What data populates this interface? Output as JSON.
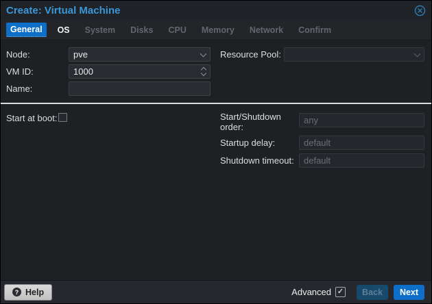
{
  "dialog": {
    "title": "Create: Virtual Machine"
  },
  "tabs": [
    {
      "label": "General",
      "state": "active"
    },
    {
      "label": "OS",
      "state": "enabled"
    },
    {
      "label": "System",
      "state": "disabled"
    },
    {
      "label": "Disks",
      "state": "disabled"
    },
    {
      "label": "CPU",
      "state": "disabled"
    },
    {
      "label": "Memory",
      "state": "disabled"
    },
    {
      "label": "Network",
      "state": "disabled"
    },
    {
      "label": "Confirm",
      "state": "disabled"
    }
  ],
  "form": {
    "node": {
      "label": "Node:",
      "value": "pve"
    },
    "vm_id": {
      "label": "VM ID:",
      "value": "1000"
    },
    "name": {
      "label": "Name:",
      "value": ""
    },
    "resource_pool": {
      "label": "Resource Pool:",
      "value": ""
    },
    "start_at_boot": {
      "label": "Start at boot:",
      "checked": false
    },
    "startup_order": {
      "label": "Start/Shutdown order:",
      "placeholder": "any",
      "value": ""
    },
    "startup_delay": {
      "label": "Startup delay:",
      "placeholder": "default",
      "value": ""
    },
    "shutdown_timeout": {
      "label": "Shutdown timeout:",
      "placeholder": "default",
      "value": ""
    }
  },
  "footer": {
    "help": "Help",
    "advanced": "Advanced",
    "advanced_checked": true,
    "back": "Back",
    "next": "Next"
  },
  "colors": {
    "accent_blue": "#0d6fc8",
    "title_blue": "#3a97d8",
    "back_button_bg": "#17496b",
    "help_button_bg": "#cdcdcd",
    "separator": "#d9dce0"
  }
}
